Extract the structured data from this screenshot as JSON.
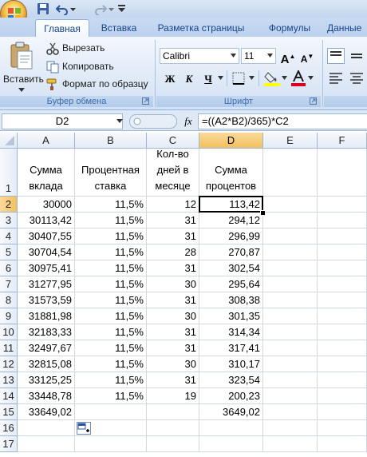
{
  "quick_access": {
    "icons": [
      "save-icon",
      "undo-icon",
      "redo-icon",
      "customize-icon"
    ]
  },
  "tabs": [
    "Главная",
    "Вставка",
    "Разметка страницы",
    "Формулы",
    "Данные"
  ],
  "ribbon": {
    "clipboard": {
      "paste_label": "Вставить",
      "cut_label": "Вырезать",
      "copy_label": "Копировать",
      "format_painter_label": "Формат по образцу",
      "group_label": "Буфер обмена"
    },
    "font": {
      "font_name": "Calibri",
      "font_size": "11",
      "bold": "Ж",
      "italic": "К",
      "underline": "Ч",
      "grow": "A",
      "shrink": "A",
      "group_label": "Шрифт",
      "fill_color": "#ffff00",
      "font_color": "#e0001b"
    }
  },
  "formula_bar": {
    "name_box": "D2",
    "fx": "fx",
    "formula": "=((A2*B2)/365)*C2"
  },
  "columns": [
    "A",
    "B",
    "C",
    "D",
    "E",
    "F"
  ],
  "rows": [
    "1",
    "2",
    "3",
    "4",
    "5",
    "6",
    "7",
    "8",
    "9",
    "10",
    "11",
    "12",
    "13",
    "14",
    "15",
    "16",
    "17"
  ],
  "header_row": {
    "a": "Сумма вклада",
    "b": "Процентная ставка",
    "c": "Кол-во дней в месяце",
    "d": "Сумма процентов"
  },
  "data_rows": [
    {
      "a": "30000",
      "b": "11,5%",
      "c": "12",
      "d": "113,42"
    },
    {
      "a": "30113,42",
      "b": "11,5%",
      "c": "31",
      "d": "294,12"
    },
    {
      "a": "30407,55",
      "b": "11,5%",
      "c": "31",
      "d": "296,99"
    },
    {
      "a": "30704,54",
      "b": "11,5%",
      "c": "28",
      "d": "270,87"
    },
    {
      "a": "30975,41",
      "b": "11,5%",
      "c": "31",
      "d": "302,54"
    },
    {
      "a": "31277,95",
      "b": "11,5%",
      "c": "30",
      "d": "295,64"
    },
    {
      "a": "31573,59",
      "b": "11,5%",
      "c": "31",
      "d": "308,38"
    },
    {
      "a": "31881,98",
      "b": "11,5%",
      "c": "30",
      "d": "301,35"
    },
    {
      "a": "32183,33",
      "b": "11,5%",
      "c": "31",
      "d": "314,34"
    },
    {
      "a": "32497,67",
      "b": "11,5%",
      "c": "31",
      "d": "317,41"
    },
    {
      "a": "32815,08",
      "b": "11,5%",
      "c": "30",
      "d": "310,17"
    },
    {
      "a": "33125,25",
      "b": "11,5%",
      "c": "31",
      "d": "323,54"
    },
    {
      "a": "33448,78",
      "b": "11,5%",
      "c": "19",
      "d": "200,23"
    }
  ],
  "totals_row": {
    "a": "33649,02",
    "d": "3649,02"
  },
  "active_cell": "D2"
}
